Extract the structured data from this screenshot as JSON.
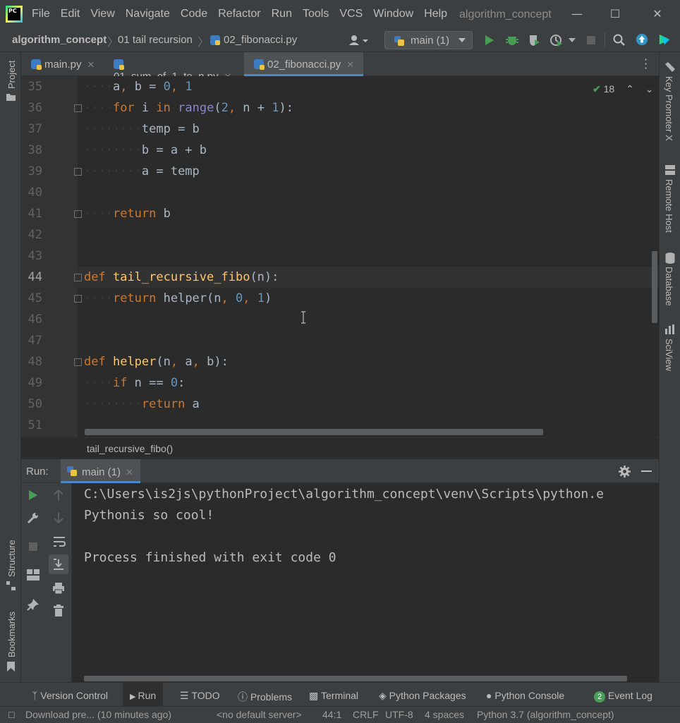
{
  "titlebar": {
    "menu": [
      "File",
      "Edit",
      "View",
      "Navigate",
      "Code",
      "Refactor",
      "Run",
      "Tools",
      "VCS",
      "Window",
      "Help"
    ],
    "window_title": "algorithm_concept",
    "logo_text": "PC"
  },
  "navbar": {
    "project": "algorithm_concept",
    "folder": "01 tail recursion",
    "file": "02_fibonacci.py",
    "run_config": "main (1)"
  },
  "tabs": [
    {
      "label": "main.py",
      "active": false
    },
    {
      "label": "01_sum_of_1_to_n.py",
      "active": false
    },
    {
      "label": "02_fibonacci.py",
      "active": true
    }
  ],
  "left_stripe": {
    "project": "Project",
    "structure": "Structure",
    "bookmarks": "Bookmarks"
  },
  "right_stripe": {
    "key_promoter": "Key Promoter X",
    "remote_host": "Remote Host",
    "database": "Database",
    "sciview": "SciView"
  },
  "editor": {
    "inspections_count": "18",
    "current_line": "44",
    "lines": [
      {
        "n": "35",
        "code": "    a, b = 0, 1"
      },
      {
        "n": "36",
        "code": "    for i in range(2, n + 1):"
      },
      {
        "n": "37",
        "code": "        temp = b"
      },
      {
        "n": "38",
        "code": "        b = a + b"
      },
      {
        "n": "39",
        "code": "        a = temp"
      },
      {
        "n": "40",
        "code": ""
      },
      {
        "n": "41",
        "code": "    return b"
      },
      {
        "n": "42",
        "code": ""
      },
      {
        "n": "43",
        "code": ""
      },
      {
        "n": "44",
        "code": "def tail_recursive_fibo(n):"
      },
      {
        "n": "45",
        "code": "    return helper(n, 0, 1)"
      },
      {
        "n": "46",
        "code": ""
      },
      {
        "n": "47",
        "code": ""
      },
      {
        "n": "48",
        "code": "def helper(n, a, b):"
      },
      {
        "n": "49",
        "code": "    if n == 0:"
      },
      {
        "n": "50",
        "code": "        return a"
      },
      {
        "n": "51",
        "code": ""
      }
    ],
    "breadcrumb": "tail_recursive_fibo()"
  },
  "run_panel": {
    "label": "Run:",
    "tab": "main (1)",
    "console": [
      "C:\\Users\\is2js\\pythonProject\\algorithm_concept\\venv\\Scripts\\python.e",
      "Pythonis so cool!",
      "",
      "Process finished with exit code 0"
    ]
  },
  "bottom_tools": [
    {
      "label": "Version Control",
      "icon": "branch-icon"
    },
    {
      "label": "Run",
      "icon": "run-icon",
      "active": true
    },
    {
      "label": "TODO",
      "icon": "list-icon"
    },
    {
      "label": "Problems",
      "icon": "info-icon"
    },
    {
      "label": "Terminal",
      "icon": "terminal-icon"
    },
    {
      "label": "Python Packages",
      "icon": "packages-icon"
    },
    {
      "label": "Python Console",
      "icon": "python-icon"
    },
    {
      "label": "Event Log",
      "icon": "event-log-icon",
      "badge": "2"
    }
  ],
  "statusbar": {
    "message": "Download pre... (10 minutes ago)",
    "server": "<no default server>",
    "position": "44:1",
    "line_sep": "CRLF",
    "encoding": "UTF-8",
    "indent": "4 spaces",
    "interpreter": "Python 3.7 (algorithm_concept)"
  },
  "colors": {
    "accent": "#4a88c7",
    "keyword": "#cc7832",
    "function": "#ffc66d",
    "number": "#6897bb",
    "run_green": "#499c54"
  }
}
